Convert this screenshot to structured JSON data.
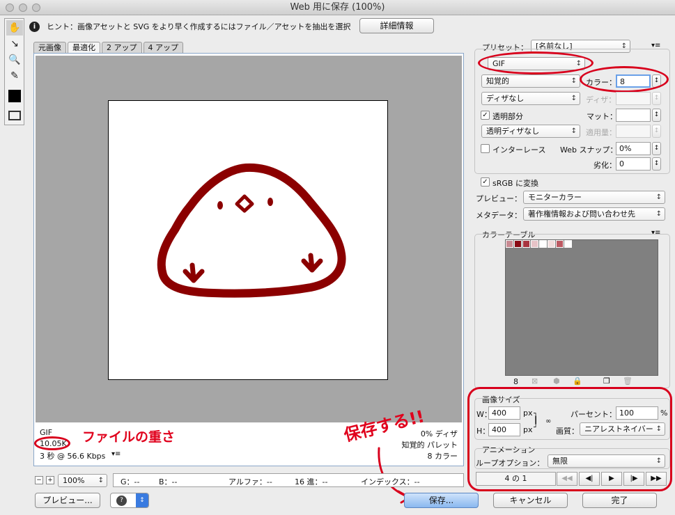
{
  "window": {
    "title": "Web 用に保存 (100%)"
  },
  "hint": {
    "text": "ヒント：画像アセットと SVG をより早く作成するにはファイル／アセットを抽出を選択",
    "detail_button": "詳細情報"
  },
  "tabs": [
    "元画像",
    "最適化",
    "2 アップ",
    "4 アップ"
  ],
  "image_info": {
    "format": "GIF",
    "size": "10.05K",
    "time": "3 秒 @ 56.6 Kbps",
    "dither": "0% ディザ",
    "palette": "知覚的 パレット",
    "colors": "8 カラー"
  },
  "annotations": {
    "filesize_note": "ファイルの重さ",
    "save_note": "保存する!!"
  },
  "settings": {
    "preset_label": "プリセット：",
    "preset_value": "[名前なし]",
    "format": "GIF",
    "reduction": "知覚的",
    "color_label": "カラー：",
    "color_value": "8",
    "dither_algo": "ディザなし",
    "dither_label": "ディザ：",
    "transparency_label": "透明部分",
    "matte_label": "マット：",
    "trans_dither": "透明ディザなし",
    "amount_label": "適用量：",
    "interlace_label": "インターレース",
    "websnap_label": "Web スナップ：",
    "websnap_value": "0%",
    "lossy_label": "劣化：",
    "lossy_value": "0",
    "srgb_label": "sRGB に変換",
    "preview_label": "プレビュー：",
    "preview_value": "モニターカラー",
    "metadata_label": "メタデータ：",
    "metadata_value": "著作権情報および問い合わせ先"
  },
  "color_table": {
    "title": "カラーテーブル",
    "count": "8",
    "colors": [
      "#c88a92",
      "#8a0a14",
      "#a83540",
      "#e6c3c7",
      "#ffffff",
      "#f2dede",
      "#bd5a63",
      "#ffffff"
    ]
  },
  "image_size": {
    "title": "画像サイズ",
    "w_label": "W：",
    "w_value": "400",
    "h_label": "H：",
    "h_value": "400",
    "unit": "px",
    "percent_label": "パーセント：",
    "percent_value": "100",
    "percent_unit": "%",
    "quality_label": "画質：",
    "quality_value": "ニアレストネイバー"
  },
  "animation": {
    "title": "アニメーション",
    "loop_label": "ループオプション：",
    "loop_value": "無限",
    "frame": "4 の 1"
  },
  "status": {
    "zoom": "100%",
    "g": "G：--",
    "b": "B：--",
    "alpha": "アルファ：--",
    "hex": "16 進：--",
    "index": "インデックス：--"
  },
  "buttons": {
    "preview": "プレビュー...",
    "save": "保存...",
    "cancel": "キャンセル",
    "done": "完了"
  },
  "colors": {
    "accent_red": "#d8001c",
    "bird_stroke": "#8b0000"
  }
}
